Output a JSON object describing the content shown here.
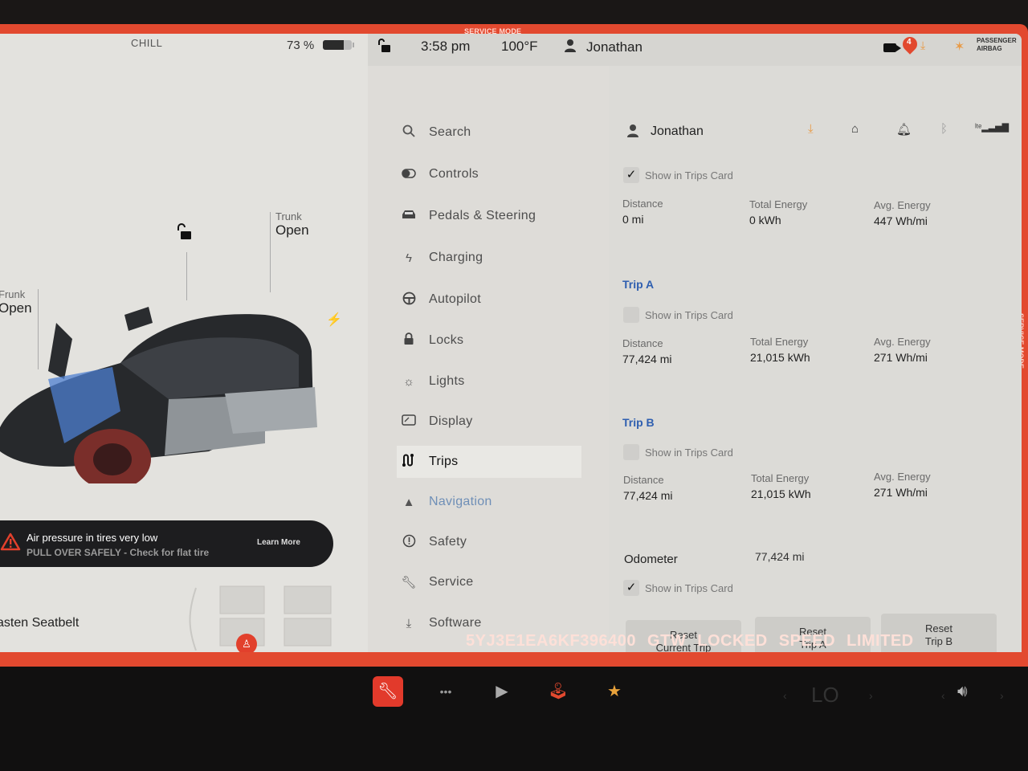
{
  "service_mode_label": "SERVICE MODE",
  "left_panel": {
    "drive_mode": "CHILL",
    "battery_percent_text": "73 %",
    "battery_level": 0.73,
    "trunk": {
      "label": "Trunk",
      "state": "Open"
    },
    "frunk": {
      "label": "Frunk",
      "state": "Open"
    },
    "alert": {
      "title": "Air pressure in tires very low",
      "subtitle": "PULL OVER SAFELY - Check for flat tire",
      "action": "Learn More"
    },
    "seatbelt_warning": "asten Seatbelt"
  },
  "status_bar": {
    "time": "3:58 pm",
    "temperature": "100°F",
    "user": "Jonathan",
    "map_pin_count": "4",
    "airbag_label": "PASSENGER AIRBAG"
  },
  "menu": {
    "active": "Trips",
    "items": [
      {
        "label": "Search",
        "icon": "search-icon"
      },
      {
        "label": "Controls",
        "icon": "toggle-icon"
      },
      {
        "label": "Pedals & Steering",
        "icon": "car-icon"
      },
      {
        "label": "Charging",
        "icon": "bolt-icon"
      },
      {
        "label": "Autopilot",
        "icon": "steering-wheel-icon"
      },
      {
        "label": "Locks",
        "icon": "lock-icon"
      },
      {
        "label": "Lights",
        "icon": "sun-icon"
      },
      {
        "label": "Display",
        "icon": "display-icon"
      },
      {
        "label": "Trips",
        "icon": "trips-icon"
      },
      {
        "label": "Navigation",
        "icon": "navigation-arrow-icon"
      },
      {
        "label": "Safety",
        "icon": "alert-circle-icon"
      },
      {
        "label": "Service",
        "icon": "wrench-icon"
      },
      {
        "label": "Software",
        "icon": "download-icon"
      }
    ]
  },
  "content": {
    "user": "Jonathan",
    "header_icons": [
      "download-icon",
      "garage-icon",
      "bell-icon",
      "bluetooth-icon",
      "lte-signal-icon"
    ],
    "current_trip": {
      "show_in_trips_card": true,
      "show_label": "Show in Trips Card",
      "distance_label": "Distance",
      "distance": "0 mi",
      "energy_label": "Total Energy",
      "energy": "0 kWh",
      "avg_label": "Avg. Energy",
      "avg": "447 Wh/mi"
    },
    "trip_a": {
      "title": "Trip A",
      "show_in_trips_card": false,
      "show_label": "Show in Trips Card",
      "distance_label": "Distance",
      "distance": "77,424 mi",
      "energy_label": "Total Energy",
      "energy": "21,015 kWh",
      "avg_label": "Avg. Energy",
      "avg": "271 Wh/mi"
    },
    "trip_b": {
      "title": "Trip B",
      "show_in_trips_card": false,
      "show_label": "Show in Trips Card",
      "distance_label": "Distance",
      "distance": "77,424 mi",
      "energy_label": "Total Energy",
      "energy": "21,015 kWh",
      "avg_label": "Avg. Energy",
      "avg": "271 Wh/mi"
    },
    "odometer": {
      "label": "Odometer",
      "value": "77,424 mi",
      "show_in_trips_card": true,
      "show_label": "Show in Trips Card"
    },
    "buttons": {
      "reset_current": "Reset\nCurrent Trip",
      "reset_a": "Reset\nTrip A",
      "reset_b": "Reset\nTrip B"
    }
  },
  "banner": {
    "vin": "5YJ3E1EA6KF396400",
    "gtw": "GTW LOCKED",
    "speed": "SPEED LIMITED"
  },
  "dock": {
    "climate": "LO",
    "items": [
      "service-app",
      "more-apps",
      "media",
      "arcade",
      "toybox"
    ]
  }
}
